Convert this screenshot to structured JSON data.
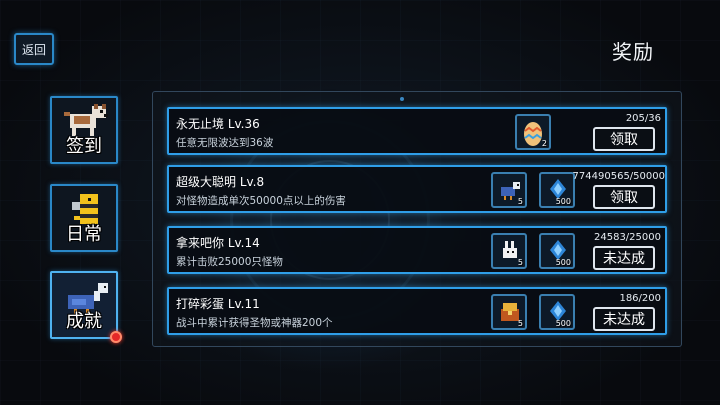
{
  "header": {
    "back_label": "返回",
    "title": "奖励"
  },
  "sidebar": {
    "items": [
      {
        "label": "签到",
        "icon": "dog-icon"
      },
      {
        "label": "日常",
        "icon": "bee-icon"
      },
      {
        "label": "成就",
        "icon": "bird-icon",
        "active": true,
        "badge": true
      }
    ]
  },
  "achievements": [
    {
      "name": "永无止境 Lv.36",
      "desc": "任意无限波达到36波",
      "progress": "205/36",
      "rewards": [
        {
          "icon": "egg-icon",
          "count": "2"
        }
      ],
      "action": "领取"
    },
    {
      "name": "超级大聪明 Lv.8",
      "desc": "对怪物造成单次50000点以上的伤害",
      "progress": "774490565/50000",
      "rewards": [
        {
          "icon": "blue-bird-icon",
          "count": "5"
        },
        {
          "icon": "blue-gem-icon",
          "count": "500"
        }
      ],
      "action": "领取"
    },
    {
      "name": "拿来吧你 Lv.14",
      "desc": "累计击败25000只怪物",
      "progress": "24583/25000",
      "rewards": [
        {
          "icon": "white-rabbit-icon",
          "count": "5"
        },
        {
          "icon": "blue-gem-icon",
          "count": "500"
        }
      ],
      "action": "未达成"
    },
    {
      "name": "打碎彩蛋 Lv.11",
      "desc": "战斗中累计获得圣物或神器200个",
      "progress": "186/200",
      "rewards": [
        {
          "icon": "treasure-icon",
          "count": "5"
        },
        {
          "icon": "blue-gem-icon",
          "count": "500"
        }
      ],
      "action": "未达成"
    }
  ],
  "colors": {
    "frame_blue": "#2f9ee8",
    "badge_red": "#e42828"
  }
}
